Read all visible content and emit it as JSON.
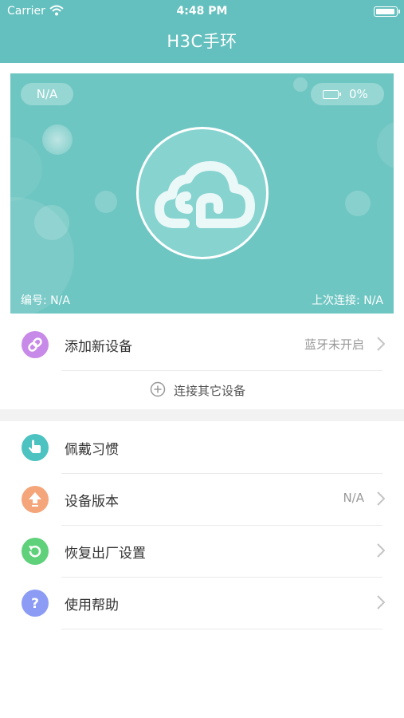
{
  "status_bar": {
    "carrier": "Carrier",
    "time": "4:48 PM",
    "icons": [
      "wifi-icon",
      "battery-icon"
    ]
  },
  "nav": {
    "title": "H3C手环"
  },
  "device_card": {
    "name_pill": "N/A",
    "battery_percent": "0%",
    "battery_level": 0,
    "serial_label": "编号: N/A",
    "last_connect_label": "上次连接: N/A",
    "center_icon": "cloud-icon",
    "colors": {
      "background": "#6ec6c2",
      "circle": "#86d3d0"
    }
  },
  "add_device": {
    "label": "添加新设备",
    "value": "蓝牙未开启",
    "icon": "link-icon",
    "icon_color": "#c88ae8"
  },
  "connect_other": {
    "label": "连接其它设备",
    "icon": "plus-circle-icon"
  },
  "menu": [
    {
      "label": "佩戴习惯",
      "value": "",
      "icon": "hand-icon",
      "icon_color": "#4cc3c0",
      "chevron": false
    },
    {
      "label": "设备版本",
      "value": "N/A",
      "icon": "upgrade-arrow-icon",
      "icon_color": "#f4a57a",
      "chevron": true
    },
    {
      "label": "恢复出厂设置",
      "value": "",
      "icon": "refresh-icon",
      "icon_color": "#5fd17a",
      "chevron": true
    },
    {
      "label": "使用帮助",
      "value": "",
      "icon": "question-icon",
      "icon_color": "#8c9cf5",
      "chevron": true
    }
  ],
  "colors": {
    "header": "#64c0be",
    "separator": "#ebebeb",
    "section_gap": "#f2f2f2"
  }
}
